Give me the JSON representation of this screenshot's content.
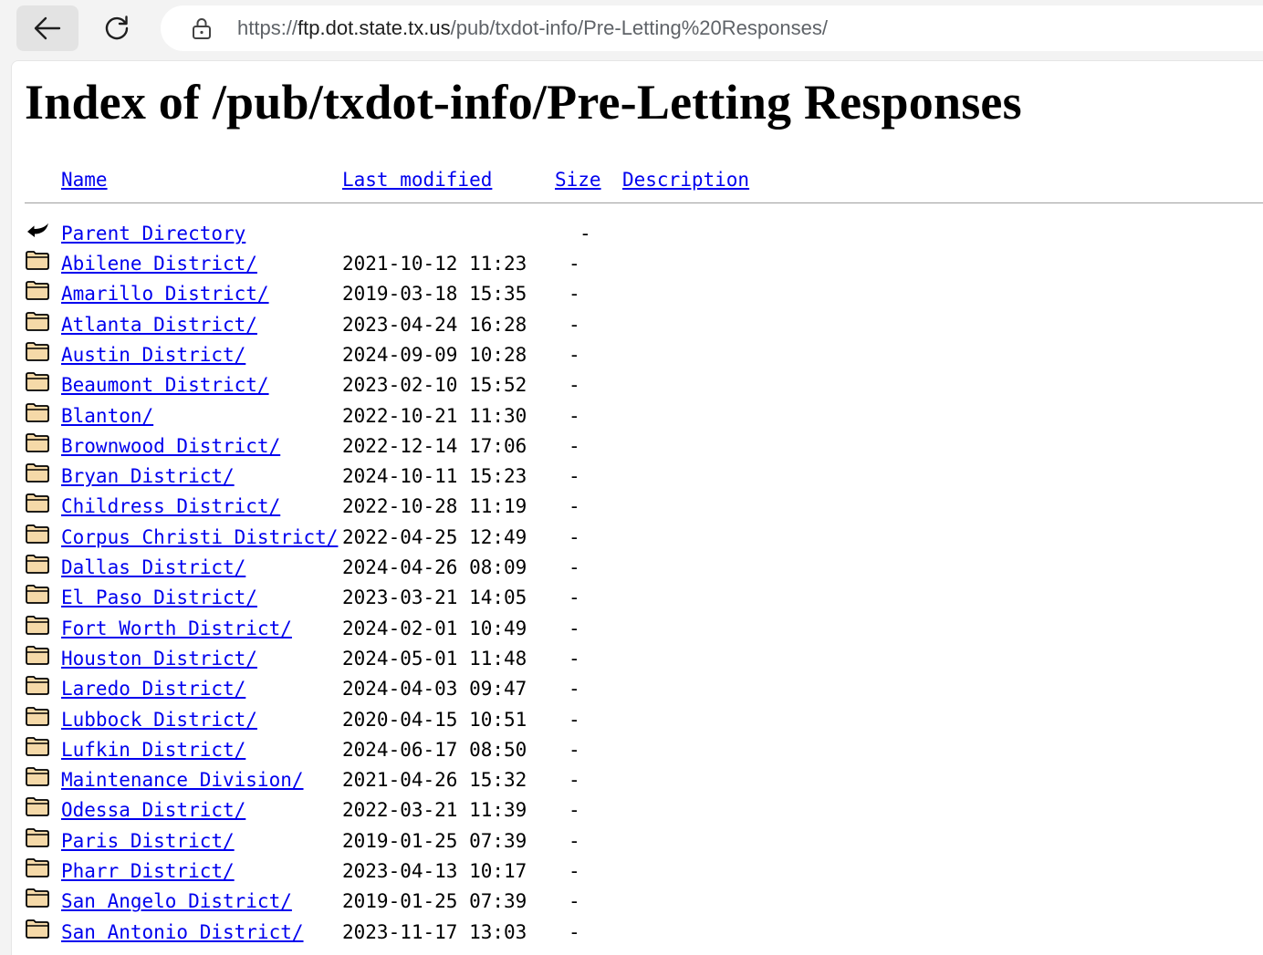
{
  "browser": {
    "url_prefix": "https://",
    "url_host": "ftp.dot.state.tx.us",
    "url_path": "/pub/txdot-info/Pre-Letting%20Responses/"
  },
  "page": {
    "title": "Index of /pub/txdot-info/Pre-Letting Responses"
  },
  "columns": {
    "name": "Name",
    "modified": "Last modified",
    "size": "Size",
    "description": "Description"
  },
  "parent": {
    "label": "Parent Directory",
    "size": "-"
  },
  "rows": [
    {
      "name": "Abilene District/",
      "modified": "2021-10-12 11:23",
      "size": "-"
    },
    {
      "name": "Amarillo District/",
      "modified": "2019-03-18 15:35",
      "size": "-"
    },
    {
      "name": "Atlanta District/",
      "modified": "2023-04-24 16:28",
      "size": "-"
    },
    {
      "name": "Austin District/",
      "modified": "2024-09-09 10:28",
      "size": "-"
    },
    {
      "name": "Beaumont District/",
      "modified": "2023-02-10 15:52",
      "size": "-"
    },
    {
      "name": "Blanton/",
      "modified": "2022-10-21 11:30",
      "size": "-"
    },
    {
      "name": "Brownwood District/",
      "modified": "2022-12-14 17:06",
      "size": "-"
    },
    {
      "name": "Bryan District/",
      "modified": "2024-10-11 15:23",
      "size": "-"
    },
    {
      "name": "Childress District/",
      "modified": "2022-10-28 11:19",
      "size": "-"
    },
    {
      "name": "Corpus Christi District/",
      "modified": "2022-04-25 12:49",
      "size": "-"
    },
    {
      "name": "Dallas District/",
      "modified": "2024-04-26 08:09",
      "size": "-"
    },
    {
      "name": "El Paso District/",
      "modified": "2023-03-21 14:05",
      "size": "-"
    },
    {
      "name": "Fort Worth District/",
      "modified": "2024-02-01 10:49",
      "size": "-"
    },
    {
      "name": "Houston District/",
      "modified": "2024-05-01 11:48",
      "size": "-"
    },
    {
      "name": "Laredo District/",
      "modified": "2024-04-03 09:47",
      "size": "-"
    },
    {
      "name": "Lubbock District/",
      "modified": "2020-04-15 10:51",
      "size": "-"
    },
    {
      "name": "Lufkin District/",
      "modified": "2024-06-17 08:50",
      "size": "-"
    },
    {
      "name": "Maintenance Division/",
      "modified": "2021-04-26 15:32",
      "size": "-"
    },
    {
      "name": "Odessa District/",
      "modified": "2022-03-21 11:39",
      "size": "-"
    },
    {
      "name": "Paris District/",
      "modified": "2019-01-25 07:39",
      "size": "-"
    },
    {
      "name": "Pharr District/",
      "modified": "2023-04-13 10:17",
      "size": "-"
    },
    {
      "name": "San Angelo District/",
      "modified": "2019-01-25 07:39",
      "size": "-"
    },
    {
      "name": "San Antonio District/",
      "modified": "2023-11-17 13:03",
      "size": "-"
    }
  ],
  "colors": {
    "link": "#0000ee",
    "folder_fill": "#f5d9a8",
    "folder_stroke": "#000000"
  }
}
